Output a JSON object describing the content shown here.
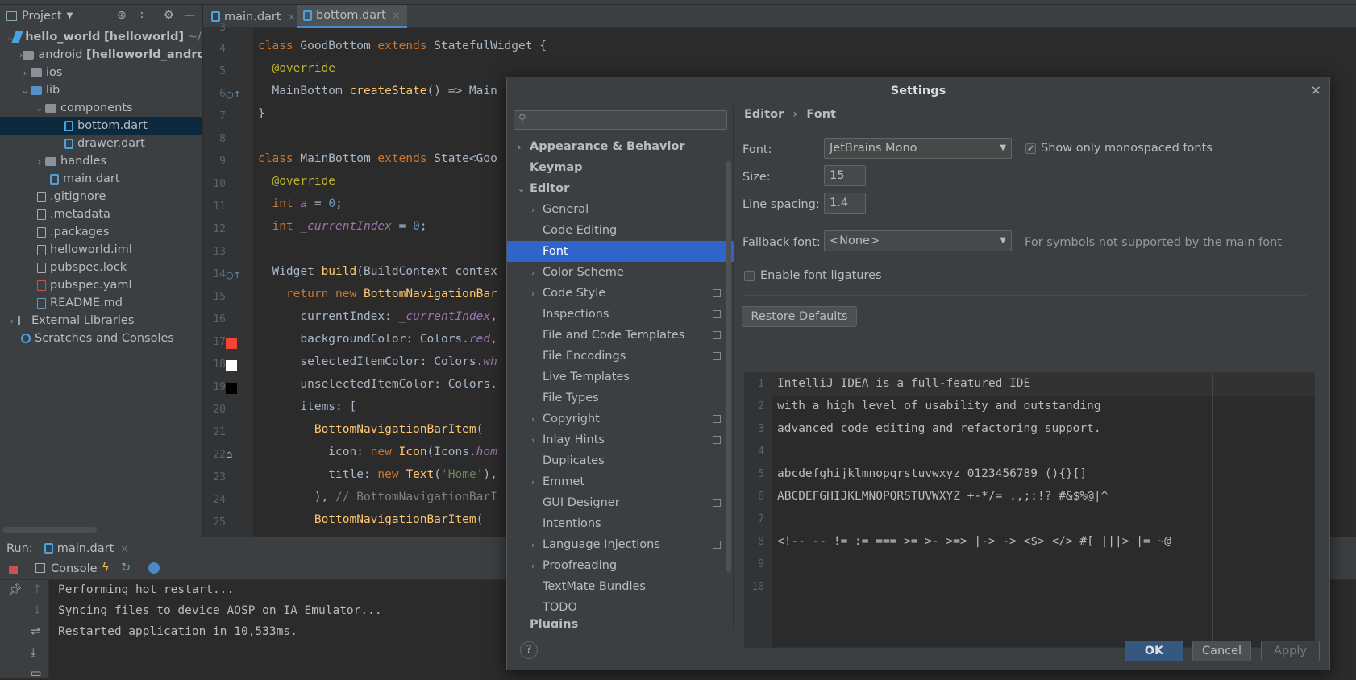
{
  "project": {
    "title": "Project",
    "tree": [
      {
        "label": "hello_world",
        "extra": "[helloworld]",
        "path": "~/D"
      },
      {
        "label": "android",
        "extra": "[helloworld_andro"
      },
      {
        "label": "ios"
      },
      {
        "label": "lib"
      },
      {
        "label": "components"
      },
      {
        "label": "bottom.dart"
      },
      {
        "label": "drawer.dart"
      },
      {
        "label": "handles"
      },
      {
        "label": "main.dart"
      },
      {
        "label": ".gitignore"
      },
      {
        "label": ".metadata"
      },
      {
        "label": ".packages"
      },
      {
        "label": "helloworld.iml"
      },
      {
        "label": "pubspec.lock"
      },
      {
        "label": "pubspec.yaml"
      },
      {
        "label": "README.md"
      },
      {
        "label": "External Libraries"
      },
      {
        "label": "Scratches and Consoles"
      }
    ]
  },
  "editor": {
    "tabs": [
      {
        "label": "main.dart"
      },
      {
        "label": "bottom.dart"
      }
    ],
    "line_numbers": [
      "3",
      "4",
      "5",
      "6",
      "7",
      "8",
      "9",
      "10",
      "11",
      "12",
      "13",
      "14",
      "15",
      "16",
      "17",
      "18",
      "19",
      "20",
      "21",
      "22",
      "23",
      "24",
      "25"
    ]
  },
  "run": {
    "label": "Run:",
    "tab": "main.dart",
    "console_tab": "Console",
    "lines": [
      "Performing hot restart...",
      "Syncing files to device AOSP on IA Emulator...",
      "Restarted application in 10,533ms."
    ]
  },
  "dialog": {
    "title": "Settings",
    "search_placeholder": "",
    "nav": [
      {
        "label": "Appearance & Behavior"
      },
      {
        "label": "Keymap"
      },
      {
        "label": "Editor"
      },
      {
        "label": "General"
      },
      {
        "label": "Code Editing"
      },
      {
        "label": "Font"
      },
      {
        "label": "Color Scheme"
      },
      {
        "label": "Code Style"
      },
      {
        "label": "Inspections"
      },
      {
        "label": "File and Code Templates"
      },
      {
        "label": "File Encodings"
      },
      {
        "label": "Live Templates"
      },
      {
        "label": "File Types"
      },
      {
        "label": "Copyright"
      },
      {
        "label": "Inlay Hints"
      },
      {
        "label": "Duplicates"
      },
      {
        "label": "Emmet"
      },
      {
        "label": "GUI Designer"
      },
      {
        "label": "Intentions"
      },
      {
        "label": "Language Injections"
      },
      {
        "label": "Proofreading"
      },
      {
        "label": "TextMate Bundles"
      },
      {
        "label": "TODO"
      },
      {
        "label": "Plugins"
      }
    ],
    "breadcrumb": {
      "parent": "Editor",
      "sep": "›",
      "current": "Font"
    },
    "font_label": "Font:",
    "font_value": "JetBrains Mono",
    "mono_only_label": "Show only monospaced fonts",
    "size_label": "Size:",
    "size_value": "15",
    "spacing_label": "Line spacing:",
    "spacing_value": "1.4",
    "fallback_label": "Fallback font:",
    "fallback_value": "<None>",
    "fallback_hint": "For symbols not supported by the main font",
    "ligatures_label": "Enable font ligatures",
    "restore_label": "Restore Defaults",
    "preview_lines": [
      {
        "n": "1",
        "t": "IntelliJ IDEA is a full-featured IDE"
      },
      {
        "n": "2",
        "t": "with a high level of usability and outstanding"
      },
      {
        "n": "3",
        "t": "advanced code editing and refactoring support."
      },
      {
        "n": "4",
        "t": ""
      },
      {
        "n": "5",
        "t": "abcdefghijklmnopqrstuvwxyz 0123456789 (){}[]"
      },
      {
        "n": "6",
        "t": "ABCDEFGHIJKLMNOPQRSTUVWXYZ +-*/= .,;:!? #&$%@|^"
      },
      {
        "n": "7",
        "t": ""
      },
      {
        "n": "8",
        "t": "<!-- -- != := === >= >- >=> |-> -> <$> </> #[ |||> |= ~@"
      },
      {
        "n": "9",
        "t": ""
      },
      {
        "n": "10",
        "t": ""
      }
    ],
    "help_label": "?",
    "ok_label": "OK",
    "cancel_label": "Cancel",
    "apply_label": "Apply"
  }
}
